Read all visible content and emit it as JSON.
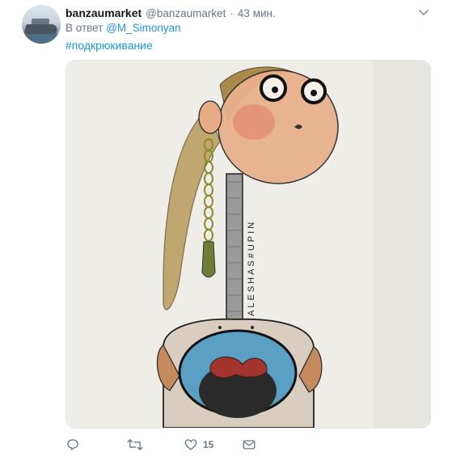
{
  "tweet": {
    "author_name": "banzaumarket",
    "author_handle": "@banzaumarket",
    "separator": "·",
    "time": "43 мин.",
    "reply_prefix": "В ответ",
    "reply_to": "@M_Simonyan",
    "hashtag": "#подкрюкивание",
    "drawing_text": "ALESHAS#UPIN",
    "likes": "15"
  },
  "icons": {
    "more": "chevron-down-icon",
    "reply": "reply-icon",
    "retweet": "retweet-icon",
    "like": "heart-icon",
    "dm": "envelope-icon"
  },
  "colors": {
    "link": "#1b95e0",
    "secondary": "#657786",
    "primary": "#14171a"
  }
}
